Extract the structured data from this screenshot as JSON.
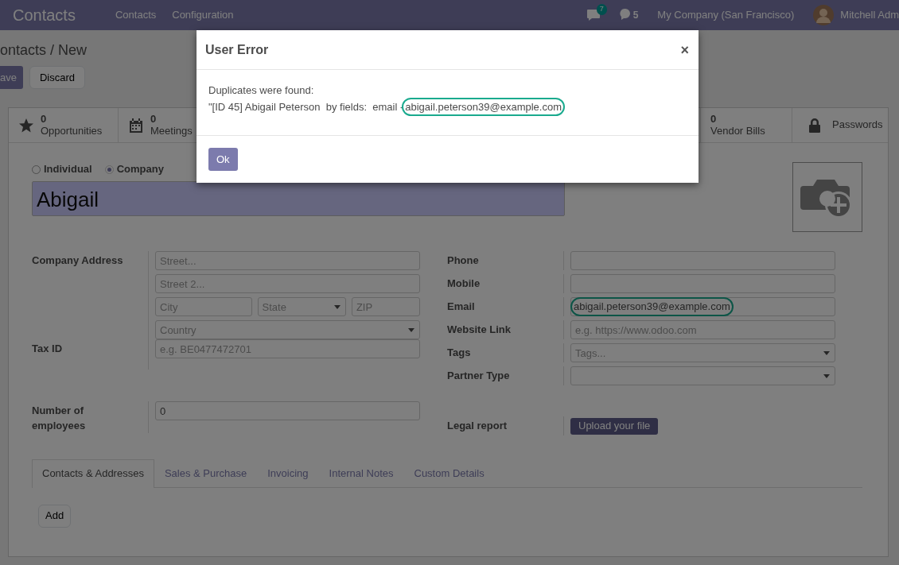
{
  "navbar": {
    "app_title": "Contacts",
    "menu": [
      "Contacts",
      "Configuration"
    ],
    "messages_badge": "7",
    "activities_badge": "5",
    "company": "My Company (San Francisco)",
    "user": "Mitchell Adm"
  },
  "breadcrumb": "ontacts / New",
  "actions": {
    "save": "ave",
    "discard": "Discard"
  },
  "stat_buttons": [
    {
      "count": "0",
      "label": "Opportunities"
    },
    {
      "count": "0",
      "label": "Meetings"
    },
    {
      "count": "0",
      "label": "Vendor Bills"
    },
    {
      "label": "Passwords"
    }
  ],
  "company_type": [
    {
      "label": "Individual",
      "selected": false
    },
    {
      "label": "Company",
      "selected": true
    }
  ],
  "name": "Abigail",
  "left_group": [
    {
      "label": "Company Address",
      "rows": [
        [
          {
            "kind": "input",
            "placeholder": "Street..."
          }
        ],
        [
          {
            "kind": "input",
            "placeholder": "Street 2..."
          }
        ],
        [
          {
            "kind": "input",
            "placeholder": "City"
          },
          {
            "kind": "select",
            "placeholder": "State"
          },
          {
            "kind": "input",
            "placeholder": "ZIP"
          }
        ],
        [
          {
            "kind": "select",
            "placeholder": "Country"
          }
        ]
      ]
    },
    {
      "label": "Tax ID",
      "rows": [
        [
          {
            "kind": "input",
            "placeholder": "e.g. BE0477472701"
          }
        ]
      ]
    },
    {
      "label": "Number of employees",
      "rows": [
        [
          {
            "kind": "input",
            "value": "0"
          }
        ]
      ]
    }
  ],
  "right_group": [
    {
      "label": "Phone",
      "field": {
        "kind": "input"
      }
    },
    {
      "label": "Mobile",
      "field": {
        "kind": "input"
      }
    },
    {
      "label": "Email",
      "field": {
        "kind": "input",
        "value": "abigail.peterson39@example.com",
        "highlighted": true
      }
    },
    {
      "label": "Website Link",
      "field": {
        "kind": "input",
        "placeholder": "e.g. https://www.odoo.com"
      }
    },
    {
      "label": "Tags",
      "field": {
        "kind": "select",
        "placeholder": "Tags..."
      }
    },
    {
      "label": "Partner Type",
      "field": {
        "kind": "select"
      }
    },
    {
      "label": "Legal report",
      "field": {
        "kind": "upload",
        "text": "Upload your file"
      }
    }
  ],
  "tabs": [
    {
      "label": "Contacts & Addresses",
      "selected": true
    },
    {
      "label": "Sales & Purchase",
      "selected": false
    },
    {
      "label": "Invoicing",
      "selected": false
    },
    {
      "label": "Internal Notes",
      "selected": false
    },
    {
      "label": "Custom Details",
      "selected": false
    }
  ],
  "add_button": "Add",
  "dialog": {
    "title": "User Error",
    "close": "×",
    "lines": [
      {
        "text": "Duplicates were found:"
      },
      {
        "text": "\"[ID 45] Abigail Peterson  by fields:  email -",
        "highlight": "abigail.peterson39@example.com"
      }
    ],
    "ok": "Ok"
  }
}
